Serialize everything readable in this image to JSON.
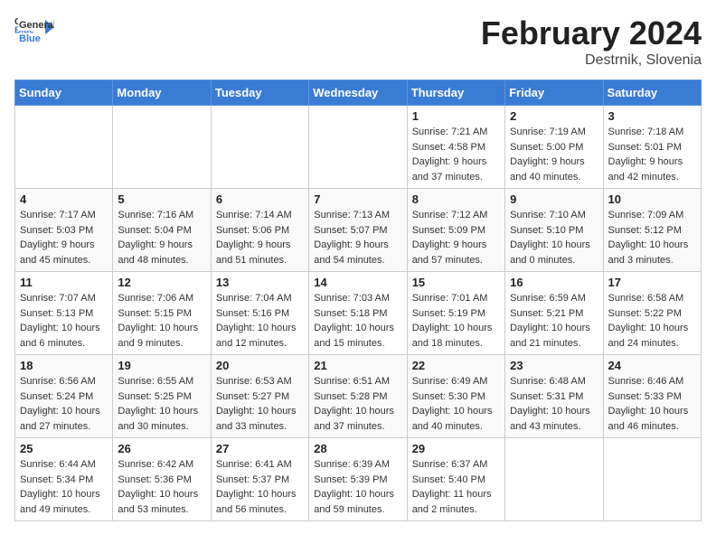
{
  "header": {
    "logo_general": "General",
    "logo_blue": "Blue",
    "month_year": "February 2024",
    "location": "Destrnik, Slovenia"
  },
  "weekdays": [
    "Sunday",
    "Monday",
    "Tuesday",
    "Wednesday",
    "Thursday",
    "Friday",
    "Saturday"
  ],
  "weeks": [
    [
      {
        "day": "",
        "info": ""
      },
      {
        "day": "",
        "info": ""
      },
      {
        "day": "",
        "info": ""
      },
      {
        "day": "",
        "info": ""
      },
      {
        "day": "1",
        "info": "Sunrise: 7:21 AM\nSunset: 4:58 PM\nDaylight: 9 hours\nand 37 minutes."
      },
      {
        "day": "2",
        "info": "Sunrise: 7:19 AM\nSunset: 5:00 PM\nDaylight: 9 hours\nand 40 minutes."
      },
      {
        "day": "3",
        "info": "Sunrise: 7:18 AM\nSunset: 5:01 PM\nDaylight: 9 hours\nand 42 minutes."
      }
    ],
    [
      {
        "day": "4",
        "info": "Sunrise: 7:17 AM\nSunset: 5:03 PM\nDaylight: 9 hours\nand 45 minutes."
      },
      {
        "day": "5",
        "info": "Sunrise: 7:16 AM\nSunset: 5:04 PM\nDaylight: 9 hours\nand 48 minutes."
      },
      {
        "day": "6",
        "info": "Sunrise: 7:14 AM\nSunset: 5:06 PM\nDaylight: 9 hours\nand 51 minutes."
      },
      {
        "day": "7",
        "info": "Sunrise: 7:13 AM\nSunset: 5:07 PM\nDaylight: 9 hours\nand 54 minutes."
      },
      {
        "day": "8",
        "info": "Sunrise: 7:12 AM\nSunset: 5:09 PM\nDaylight: 9 hours\nand 57 minutes."
      },
      {
        "day": "9",
        "info": "Sunrise: 7:10 AM\nSunset: 5:10 PM\nDaylight: 10 hours\nand 0 minutes."
      },
      {
        "day": "10",
        "info": "Sunrise: 7:09 AM\nSunset: 5:12 PM\nDaylight: 10 hours\nand 3 minutes."
      }
    ],
    [
      {
        "day": "11",
        "info": "Sunrise: 7:07 AM\nSunset: 5:13 PM\nDaylight: 10 hours\nand 6 minutes."
      },
      {
        "day": "12",
        "info": "Sunrise: 7:06 AM\nSunset: 5:15 PM\nDaylight: 10 hours\nand 9 minutes."
      },
      {
        "day": "13",
        "info": "Sunrise: 7:04 AM\nSunset: 5:16 PM\nDaylight: 10 hours\nand 12 minutes."
      },
      {
        "day": "14",
        "info": "Sunrise: 7:03 AM\nSunset: 5:18 PM\nDaylight: 10 hours\nand 15 minutes."
      },
      {
        "day": "15",
        "info": "Sunrise: 7:01 AM\nSunset: 5:19 PM\nDaylight: 10 hours\nand 18 minutes."
      },
      {
        "day": "16",
        "info": "Sunrise: 6:59 AM\nSunset: 5:21 PM\nDaylight: 10 hours\nand 21 minutes."
      },
      {
        "day": "17",
        "info": "Sunrise: 6:58 AM\nSunset: 5:22 PM\nDaylight: 10 hours\nand 24 minutes."
      }
    ],
    [
      {
        "day": "18",
        "info": "Sunrise: 6:56 AM\nSunset: 5:24 PM\nDaylight: 10 hours\nand 27 minutes."
      },
      {
        "day": "19",
        "info": "Sunrise: 6:55 AM\nSunset: 5:25 PM\nDaylight: 10 hours\nand 30 minutes."
      },
      {
        "day": "20",
        "info": "Sunrise: 6:53 AM\nSunset: 5:27 PM\nDaylight: 10 hours\nand 33 minutes."
      },
      {
        "day": "21",
        "info": "Sunrise: 6:51 AM\nSunset: 5:28 PM\nDaylight: 10 hours\nand 37 minutes."
      },
      {
        "day": "22",
        "info": "Sunrise: 6:49 AM\nSunset: 5:30 PM\nDaylight: 10 hours\nand 40 minutes."
      },
      {
        "day": "23",
        "info": "Sunrise: 6:48 AM\nSunset: 5:31 PM\nDaylight: 10 hours\nand 43 minutes."
      },
      {
        "day": "24",
        "info": "Sunrise: 6:46 AM\nSunset: 5:33 PM\nDaylight: 10 hours\nand 46 minutes."
      }
    ],
    [
      {
        "day": "25",
        "info": "Sunrise: 6:44 AM\nSunset: 5:34 PM\nDaylight: 10 hours\nand 49 minutes."
      },
      {
        "day": "26",
        "info": "Sunrise: 6:42 AM\nSunset: 5:36 PM\nDaylight: 10 hours\nand 53 minutes."
      },
      {
        "day": "27",
        "info": "Sunrise: 6:41 AM\nSunset: 5:37 PM\nDaylight: 10 hours\nand 56 minutes."
      },
      {
        "day": "28",
        "info": "Sunrise: 6:39 AM\nSunset: 5:39 PM\nDaylight: 10 hours\nand 59 minutes."
      },
      {
        "day": "29",
        "info": "Sunrise: 6:37 AM\nSunset: 5:40 PM\nDaylight: 11 hours\nand 2 minutes."
      },
      {
        "day": "",
        "info": ""
      },
      {
        "day": "",
        "info": ""
      }
    ]
  ]
}
